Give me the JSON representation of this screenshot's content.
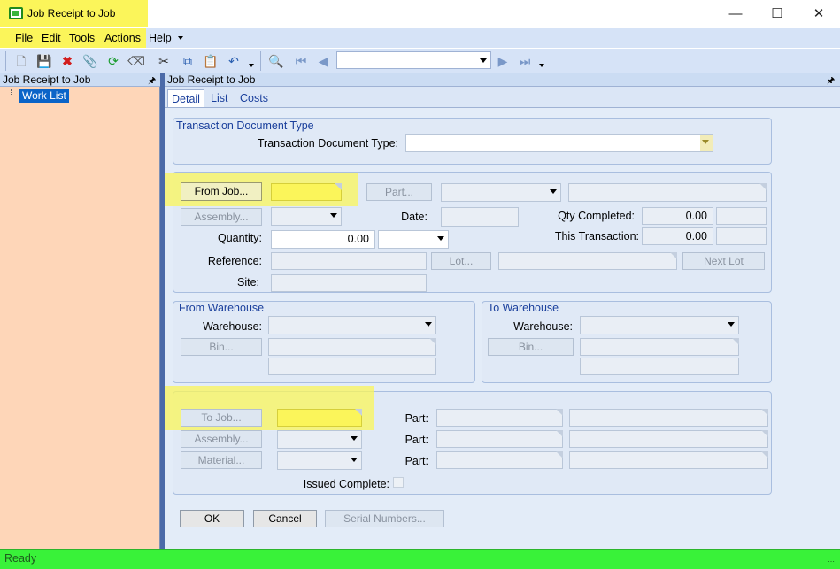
{
  "window": {
    "title": "Job Receipt to Job",
    "controls": [
      "minimize",
      "maximize",
      "close"
    ]
  },
  "menu": {
    "items": [
      "File",
      "Edit",
      "Tools",
      "Actions",
      "Help"
    ]
  },
  "left_pane": {
    "title": "Job Receipt to Job",
    "tree_item": "Work List"
  },
  "right_pane": {
    "title": "Job Receipt to Job"
  },
  "tabs": [
    "Detail",
    "List",
    "Costs"
  ],
  "doc_type": {
    "group_title": "Transaction Document Type",
    "label": "Transaction Document Type:",
    "value": ""
  },
  "from_job": {
    "from_job_button": "From Job...",
    "assembly_button": "Assembly...",
    "part_button": "Part...",
    "date_label": "Date:",
    "quantity_label": "Quantity:",
    "quantity_value": "0.00",
    "reference_label": "Reference:",
    "site_label": "Site:",
    "lot_button": "Lot...",
    "next_lot_button": "Next Lot",
    "qty_completed_label": "Qty Completed:",
    "qty_completed_value": "0.00",
    "this_transaction_label": "This Transaction:",
    "this_transaction_value": "0.00"
  },
  "from_warehouse": {
    "group_title": "From Warehouse",
    "warehouse_label": "Warehouse:",
    "bin_button": "Bin..."
  },
  "to_warehouse": {
    "group_title": "To Warehouse",
    "warehouse_label": "Warehouse:",
    "bin_button": "Bin..."
  },
  "to_job": {
    "to_job_button": "To Job...",
    "assembly_button": "Assembly...",
    "material_button": "Material...",
    "part_label": "Part:",
    "issued_complete_label": "Issued Complete:"
  },
  "actions": {
    "ok": "OK",
    "cancel": "Cancel",
    "serial_numbers": "Serial Numbers..."
  },
  "status": {
    "text": "Ready"
  },
  "colors": {
    "highlight": "#fbf55a",
    "status_bar": "#39f239",
    "left_pane": "#fed6b8"
  }
}
